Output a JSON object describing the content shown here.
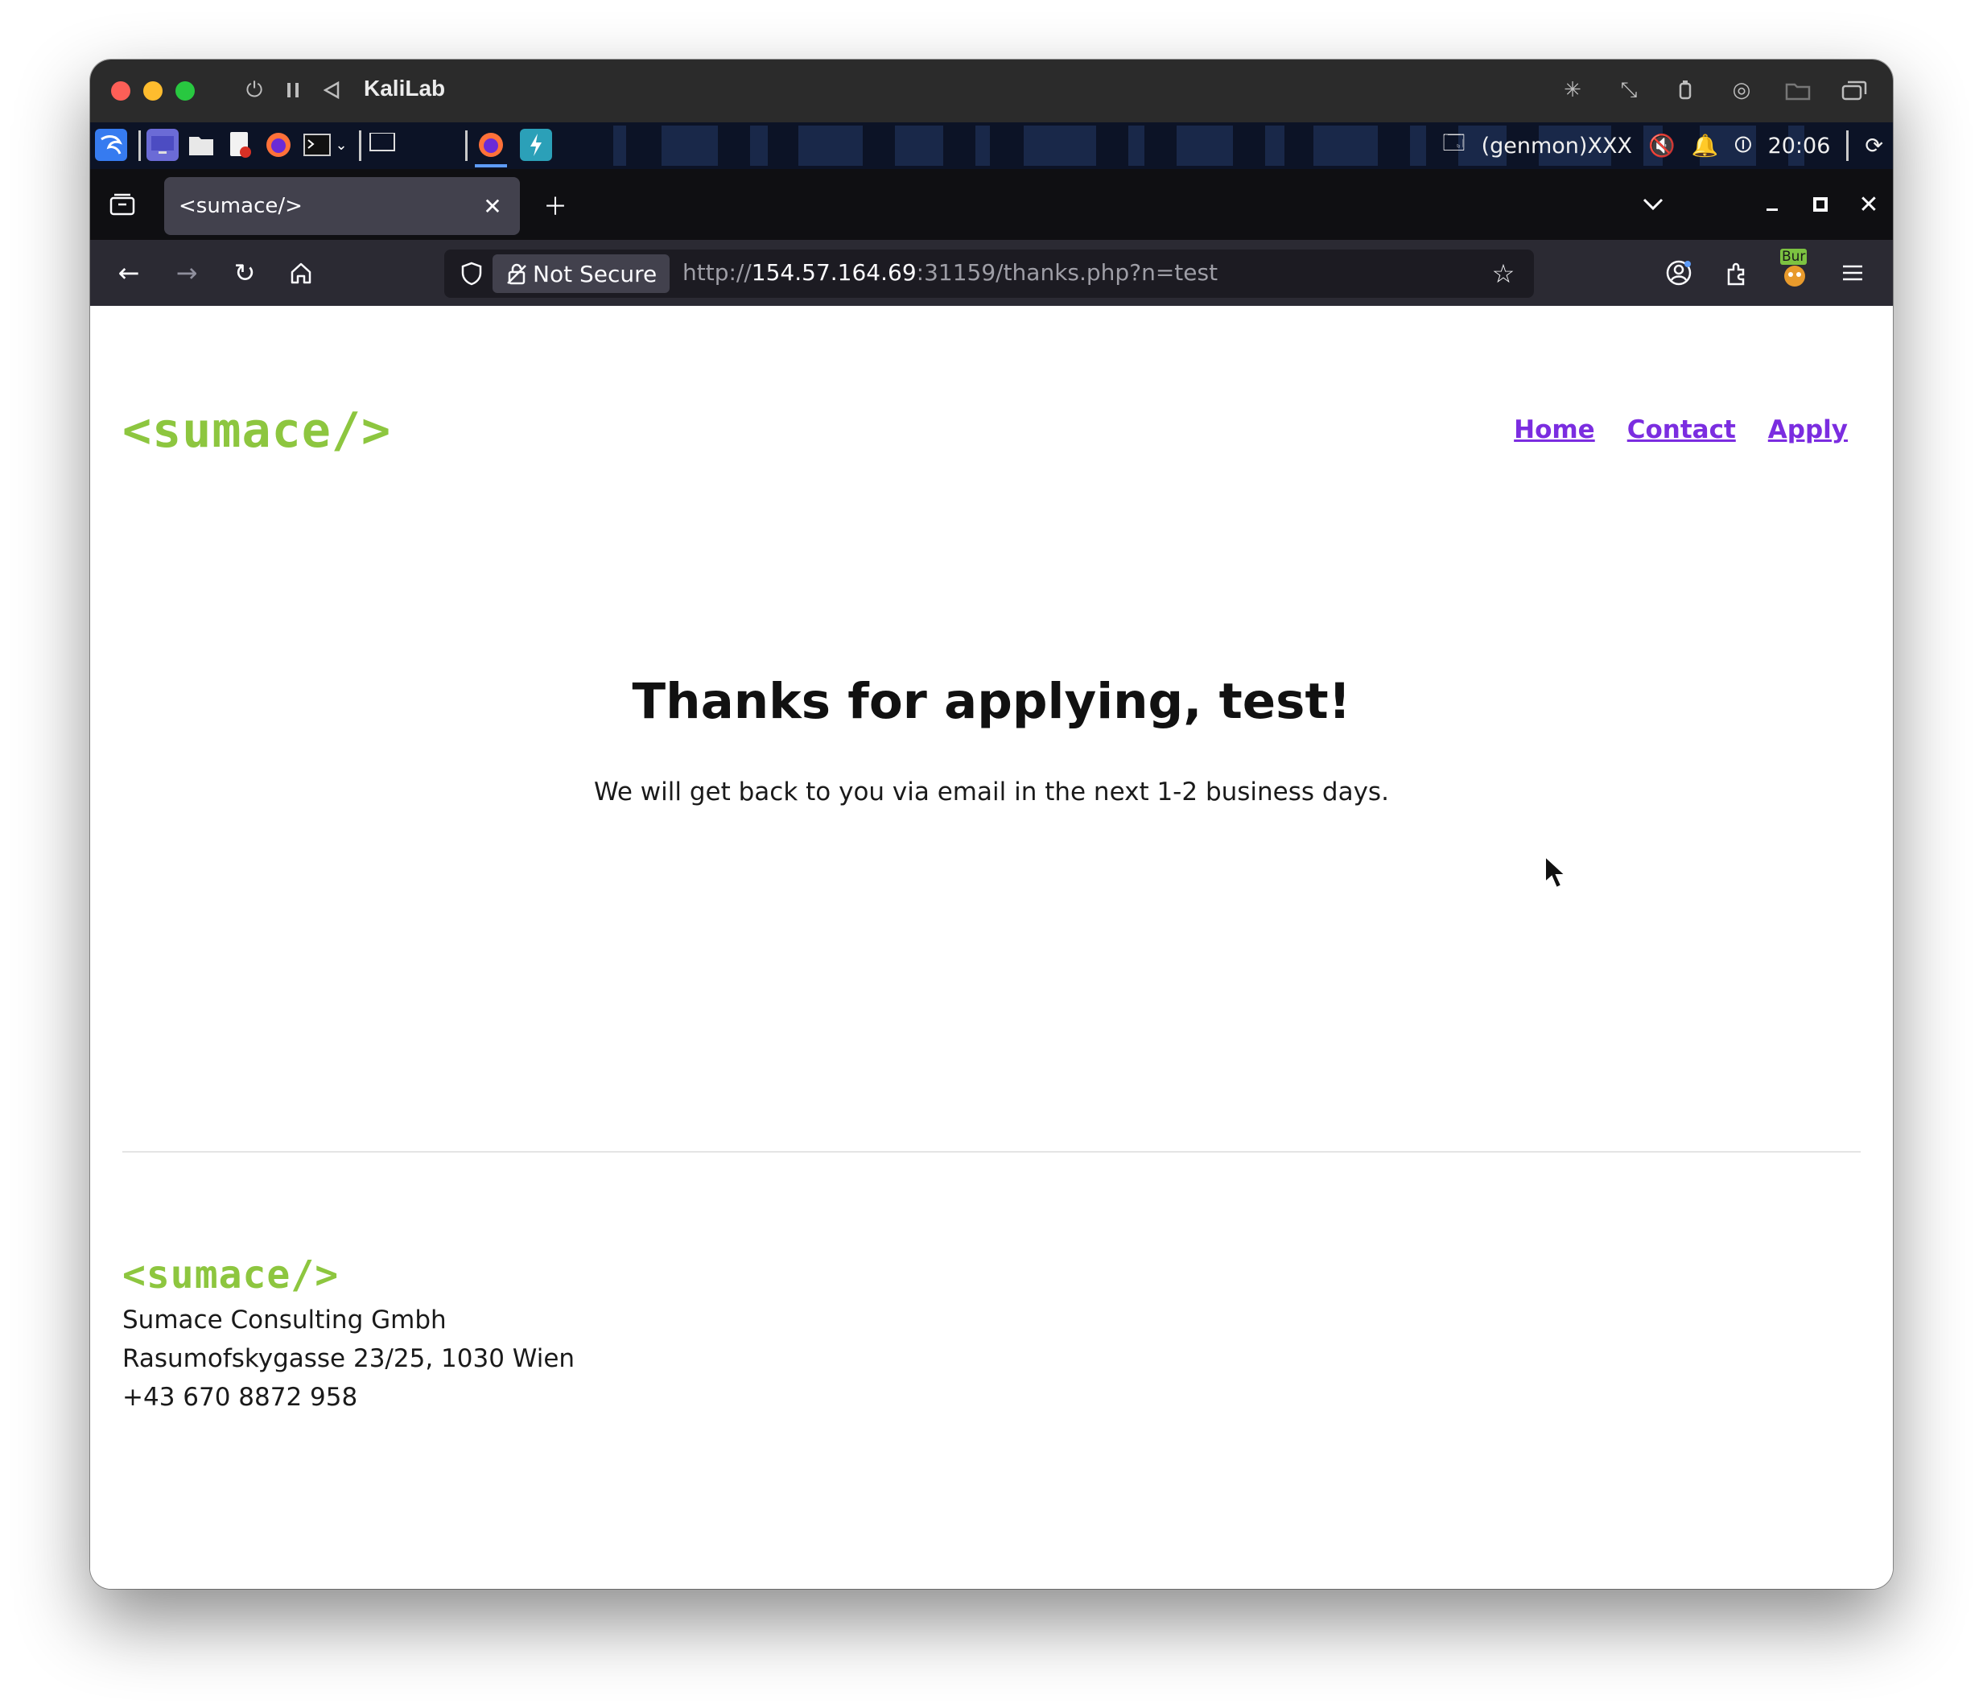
{
  "vm": {
    "title": "KaliLab"
  },
  "panel": {
    "genmon": "(genmon)XXX",
    "clock": "20:06"
  },
  "browser": {
    "tab_title": "<sumace/>",
    "security_label": "Not Secure",
    "url": {
      "scheme": "http://",
      "host": "154.57.164.69",
      "rest": ":31159/thanks.php?n=test"
    },
    "burp_badge": "Bur"
  },
  "site": {
    "logo": "<sumace/>",
    "nav": [
      "Home",
      "Contact",
      "Apply"
    ]
  },
  "main": {
    "heading": "Thanks for applying, test!",
    "message": "We will get back to you via email in the next 1-2 business days."
  },
  "footer": {
    "logo": "<sumace/>",
    "company": "Sumace Consulting Gmbh",
    "address": "Rasumofskygasse 23/25, 1030 Wien",
    "phone": "+43 670 8872 958"
  }
}
